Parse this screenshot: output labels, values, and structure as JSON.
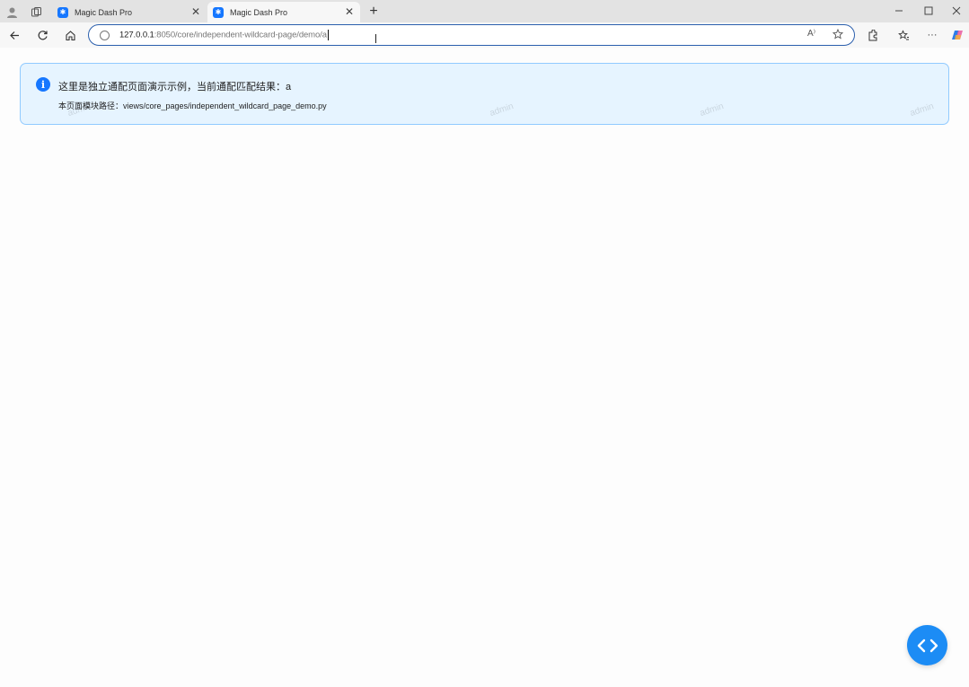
{
  "browser": {
    "tabs": [
      {
        "title": "Magic Dash Pro",
        "active": false
      },
      {
        "title": "Magic Dash Pro",
        "active": true
      }
    ],
    "close_glyph": "✕",
    "new_tab_glyph": "+",
    "address": {
      "host": "127.0.0.1",
      "path": ":8050/core/independent-wildcard-page/demo/a"
    },
    "icons": {
      "profile": "profile-icon",
      "workspaces": "workspaces-icon",
      "back": "back-arrow-icon",
      "refresh": "refresh-icon",
      "home": "home-icon",
      "read_aloud": "read-aloud-icon",
      "favorite": "star-icon",
      "extensions": "extensions-icon",
      "favorites": "favorites-icon",
      "more": "more-icon",
      "copilot": "copilot-icon"
    },
    "read_aloud_glyph": "A⁾",
    "more_glyph": "···"
  },
  "alert": {
    "message": "这里是独立通配页面演示示例，当前通配匹配结果：a",
    "description": "本页面模块路径：views/core_pages/independent_wildcard_page_demo.py",
    "icon": "info-circle-icon",
    "icon_glyph": "i"
  },
  "watermark": {
    "text": "admin"
  },
  "fab": {
    "icon": "code-icon"
  },
  "colors": {
    "accent": "#1677ff",
    "alert_bg": "#e6f4ff",
    "alert_border": "#91caff",
    "fab_bg": "#1c8cf5"
  }
}
